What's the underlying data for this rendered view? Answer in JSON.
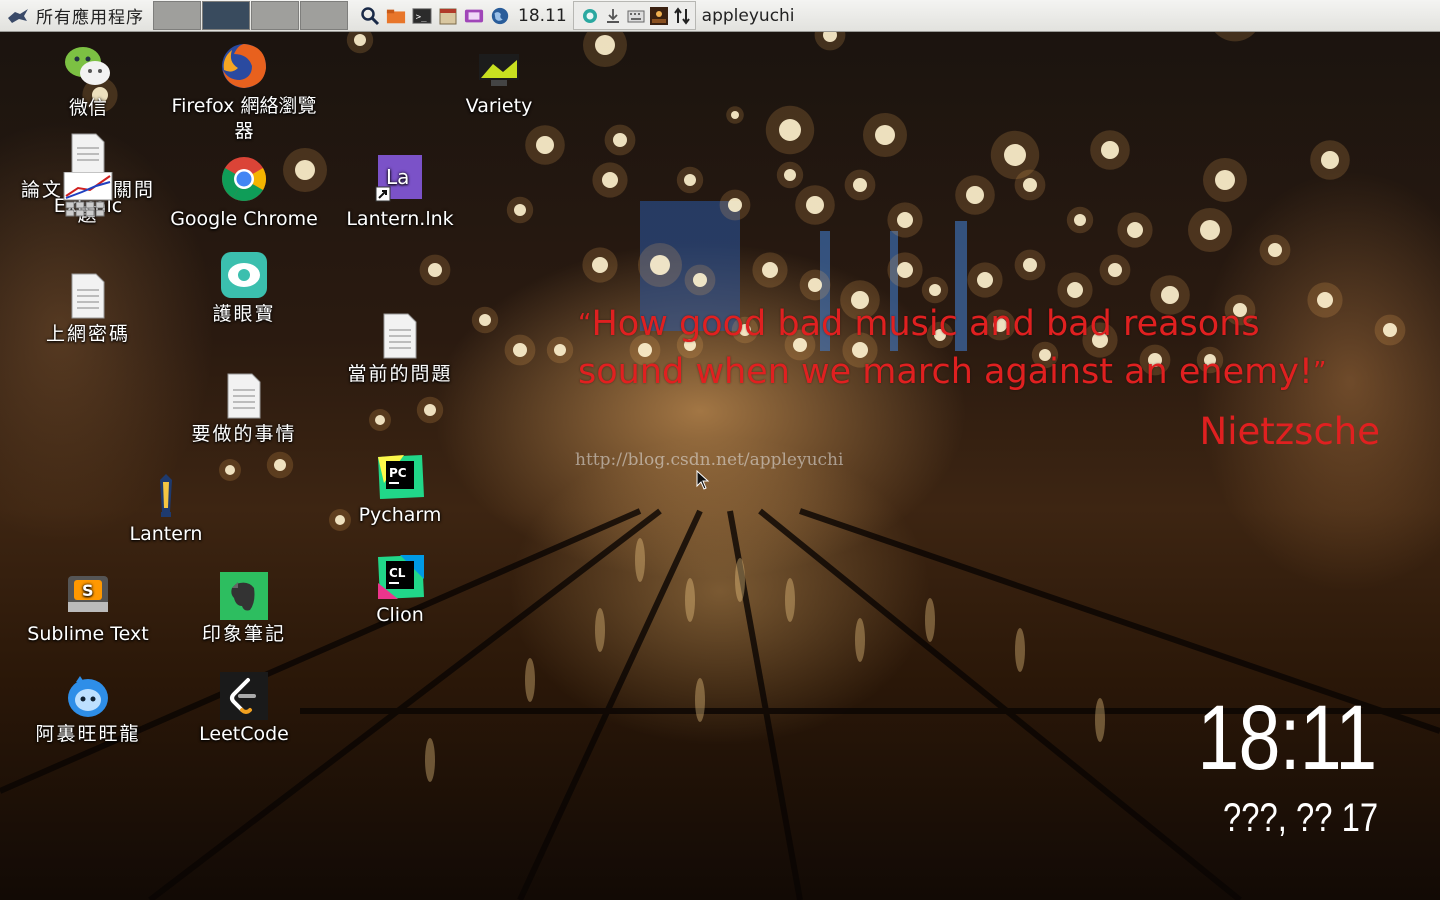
{
  "taskbar": {
    "menu_label": "所有應用程序",
    "clock": "18.11",
    "user": "appleyuchi",
    "workspaces": 4,
    "active_workspace": 2,
    "launchers": [
      "search-icon",
      "file-manager-icon",
      "terminal-icon",
      "archive-icon",
      "media-icon",
      "browser-globe-icon"
    ],
    "tray": [
      "sync-icon",
      "download-icon",
      "keyboard-icon",
      "image-viewer-icon",
      "network-arrows-icon"
    ]
  },
  "desktop": {
    "icons": [
      {
        "id": "wechat",
        "label": "微信",
        "icon": "wechat-icon"
      },
      {
        "id": "firefox",
        "label": "Firefox 網絡瀏覽器",
        "icon": "firefox-icon"
      },
      {
        "id": "variety",
        "label": "Variety",
        "icon": "variety-icon"
      },
      {
        "id": "paper-doc",
        "label": "論文 的相關問題",
        "icon": "document-icon"
      },
      {
        "id": "extcalc",
        "label": "Extcalc",
        "icon": "calculator-graph-icon"
      },
      {
        "id": "chrome",
        "label": "Google Chrome",
        "icon": "chrome-icon"
      },
      {
        "id": "lantern-lnk",
        "label": "Lantern.lnk",
        "icon": "lantern-shortcut-icon"
      },
      {
        "id": "password-doc",
        "label": "上網密碼",
        "icon": "document-icon"
      },
      {
        "id": "eye-care",
        "label": "護眼寶",
        "icon": "eye-care-icon"
      },
      {
        "id": "current-issues",
        "label": "當前的問題",
        "icon": "document-icon"
      },
      {
        "id": "todo",
        "label": "要做的事情",
        "icon": "document-icon"
      },
      {
        "id": "lantern",
        "label": "Lantern",
        "icon": "lantern-icon"
      },
      {
        "id": "pycharm",
        "label": "Pycharm",
        "icon": "pycharm-icon"
      },
      {
        "id": "sublime",
        "label": "Sublime Text",
        "icon": "sublime-icon"
      },
      {
        "id": "evernote",
        "label": "印象筆記",
        "icon": "evernote-icon"
      },
      {
        "id": "clion",
        "label": "Clion",
        "icon": "clion-icon"
      },
      {
        "id": "aliwangwang",
        "label": "阿裏旺旺龍",
        "icon": "aliwangwang-icon"
      },
      {
        "id": "leetcode",
        "label": "LeetCode",
        "icon": "leetcode-icon"
      }
    ]
  },
  "wallpaper": {
    "quote_open": "“",
    "quote_text": "How good bad music and bad reasons sound when we march against an enemy!",
    "quote_close": "”",
    "author": "Nietzsche",
    "watermark": "http://blog.csdn.net/appleyuchi"
  },
  "clock_widget": {
    "time": "18:11",
    "date": "???, ?? 17"
  },
  "colors": {
    "quote": "#e02020",
    "panel_bg": "#e8e8e5",
    "active_workspace": "#394b5e"
  }
}
